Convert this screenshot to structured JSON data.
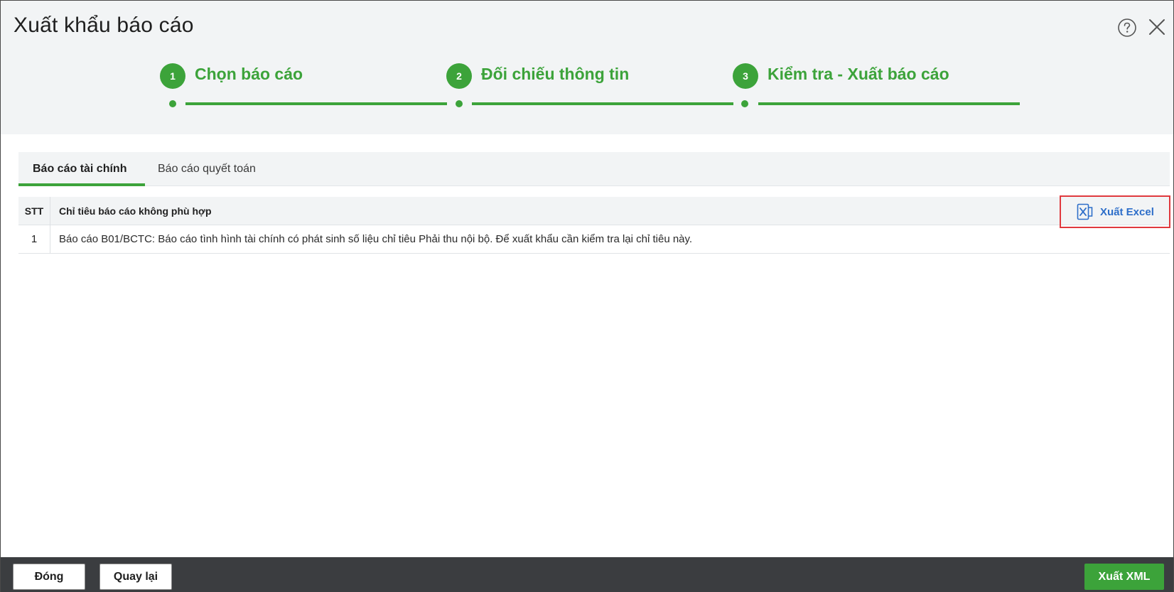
{
  "dialog": {
    "title": "Xuất khẩu báo cáo"
  },
  "steps": [
    {
      "number": "1",
      "label": "Chọn báo cáo"
    },
    {
      "number": "2",
      "label": "Đối chiếu thông tin"
    },
    {
      "number": "3",
      "label": "Kiểm tra - Xuất báo cáo"
    }
  ],
  "tabs": [
    {
      "label": "Báo cáo tài chính",
      "active": true
    },
    {
      "label": "Báo cáo quyết toán",
      "active": false
    }
  ],
  "table": {
    "columns": [
      "STT",
      "Chỉ tiêu báo cáo không phù hợp"
    ],
    "rows": [
      {
        "stt": "1",
        "description": "Báo cáo B01/BCTC: Báo cáo tình hình tài chính có phát sinh số liệu chỉ tiêu Phải thu nội bộ. Để xuất khẩu cần kiểm tra lại chỉ tiêu này."
      }
    ],
    "export_excel_label": "Xuất Excel"
  },
  "footer": {
    "close_label": "Đóng",
    "back_label": "Quay lại",
    "export_xml_label": "Xuất XML"
  },
  "colors": {
    "accent": "#3ca33a",
    "link": "#2d6ec9",
    "highlight_border": "#e0393e",
    "footer_bg": "#3b3d40"
  },
  "icons": {
    "help": "help-circle-icon",
    "close": "close-icon",
    "excel": "excel-icon"
  }
}
